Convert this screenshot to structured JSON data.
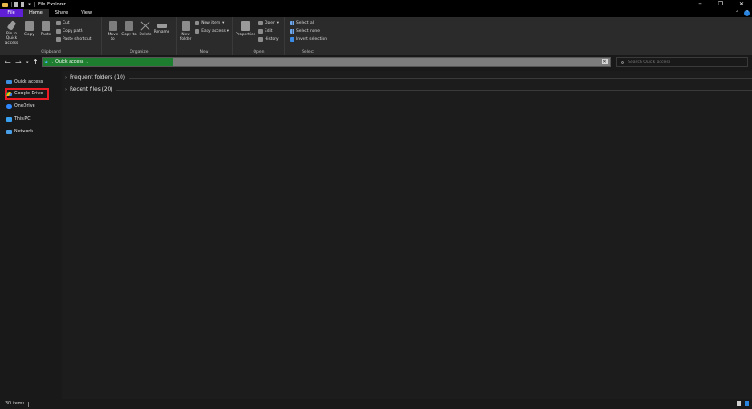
{
  "window": {
    "title": "File Explorer"
  },
  "tabs": [
    "File",
    "Home",
    "Share",
    "View"
  ],
  "ribbon": {
    "clipboard": {
      "label": "Clipboard",
      "pin": "Pin to Quick access",
      "copy": "Copy",
      "paste": "Paste",
      "cut": "Cut",
      "copy_path": "Copy path",
      "paste_shortcut": "Paste shortcut"
    },
    "organize": {
      "label": "Organize",
      "move_to": "Move to",
      "copy_to": "Copy to",
      "delete": "Delete",
      "rename": "Rename"
    },
    "new": {
      "label": "New",
      "new_folder": "New folder",
      "new_item": "New item",
      "easy_access": "Easy access"
    },
    "open": {
      "label": "Open",
      "properties": "Properties",
      "open": "Open",
      "edit": "Edit",
      "history": "History"
    },
    "select": {
      "label": "Select",
      "select_all": "Select all",
      "select_none": "Select none",
      "invert": "Invert selection"
    }
  },
  "address": {
    "location": "Quick access",
    "progress": 0.23
  },
  "search": {
    "placeholder": "Search Quick access"
  },
  "navpane": [
    "Quick access",
    "Google Drive",
    "OneDrive",
    "This PC",
    "Network"
  ],
  "sections": [
    "Frequent folders (10)",
    "Recent files (20)"
  ],
  "status": {
    "items": "30 items"
  },
  "colors": {
    "file_tab": "#5e1fd6",
    "address_fill": "#1d7e2f",
    "highlight": "#ee1c24"
  }
}
